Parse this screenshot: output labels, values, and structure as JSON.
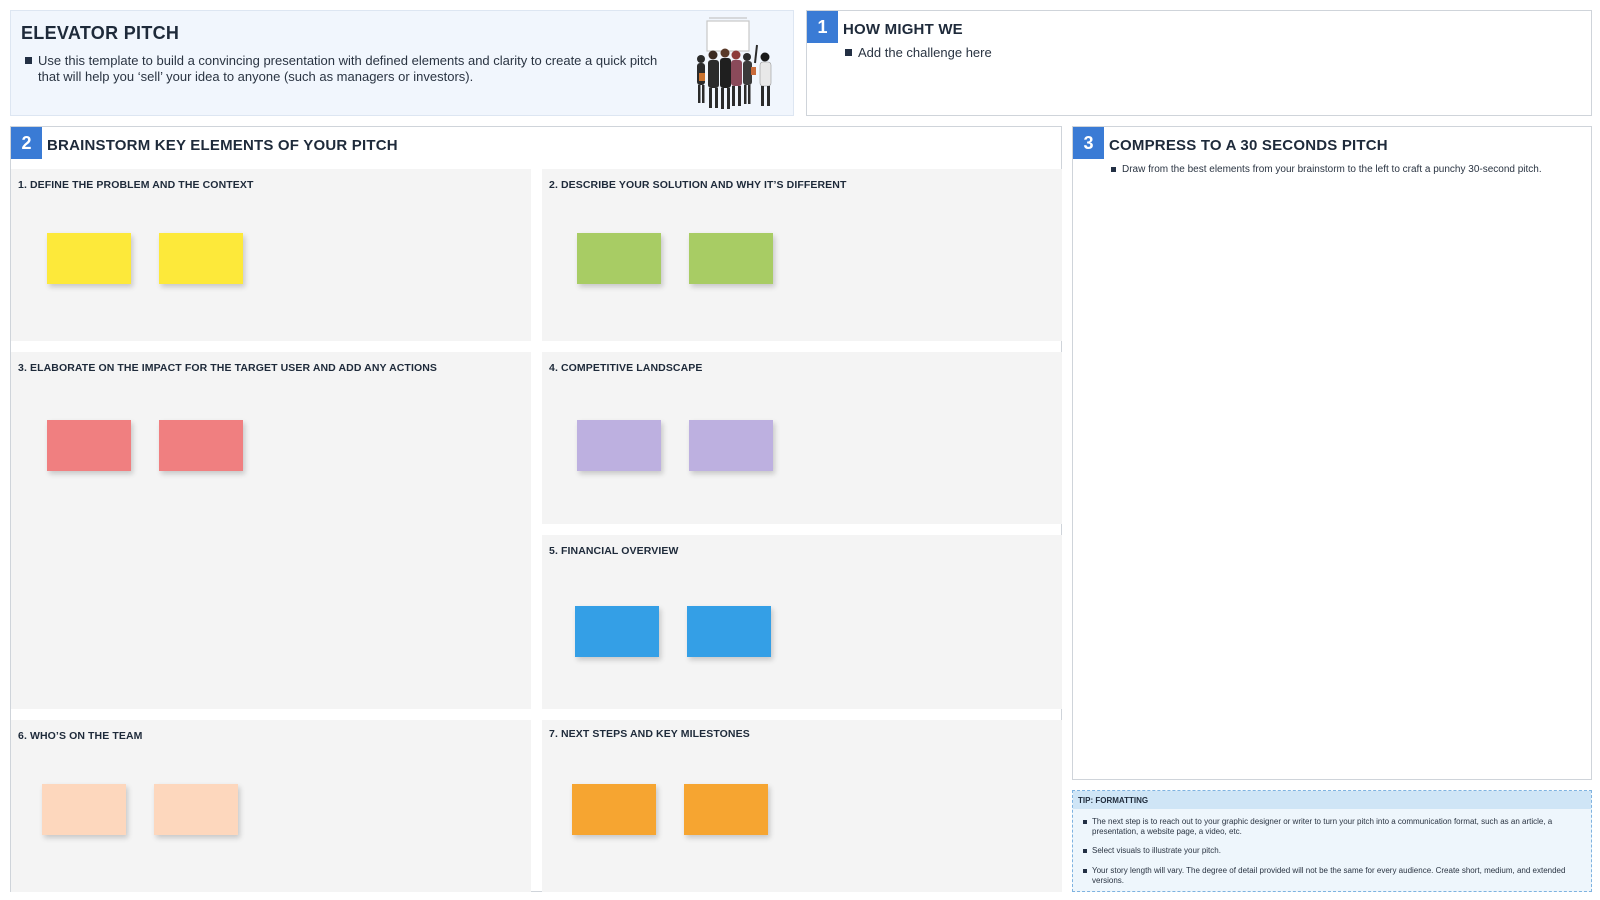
{
  "intro": {
    "title": "ELEVATOR PITCH",
    "description": "Use this template to build a convincing presentation with defined elements and clarity to create a quick pitch that will help you ‘sell’ your idea to anyone (such as managers or investors)."
  },
  "frame1": {
    "number": "1",
    "title": "HOW MIGHT WE",
    "item": "Add the challenge here"
  },
  "frame2": {
    "number": "2",
    "title": "BRAINSTORM KEY ELEMENTS OF YOUR PITCH",
    "sections": [
      {
        "label": "1.  DEFINE THE PROBLEM AND THE CONTEXT",
        "note_color": "#fde93a"
      },
      {
        "label": "2.  DESCRIBE YOUR SOLUTION AND WHY IT’S DIFFERENT",
        "note_color": "#a8cc64"
      },
      {
        "label": "3. ELABORATE ON THE IMPACT FOR THE TARGET USER AND ADD ANY ACTIONS",
        "note_color": "#f07f80"
      },
      {
        "label": "4. COMPETITIVE LANDSCAPE",
        "note_color": "#bdb0e0"
      },
      {
        "label": "5. FINANCIAL OVERVIEW",
        "note_color": "#349fe6"
      },
      {
        "label": "6. WHO’S ON THE TEAM",
        "note_color": "#fdd7bd"
      },
      {
        "label": "7. NEXT STEPS AND KEY MILESTONES",
        "note_color": "#f6a531"
      }
    ]
  },
  "frame3": {
    "number": "3",
    "title": "COMPRESS TO A 30 SECONDS PITCH",
    "item": "Draw from the best elements from your brainstorm to the left to craft a punchy 30-second pitch."
  },
  "tip": {
    "title": "TIP: FORMATTING",
    "items": [
      "The next step is to reach out to your graphic designer or writer to turn your pitch into a communication format, such as an article, a presentation, a website page, a video, etc.",
      "Select visuals to illustrate your pitch.",
      "Your story length will vary. The degree of detail provided will not be the same for every audience. Create short, medium, and extended versions."
    ]
  },
  "icons": {
    "people": "people-group-illustration"
  }
}
